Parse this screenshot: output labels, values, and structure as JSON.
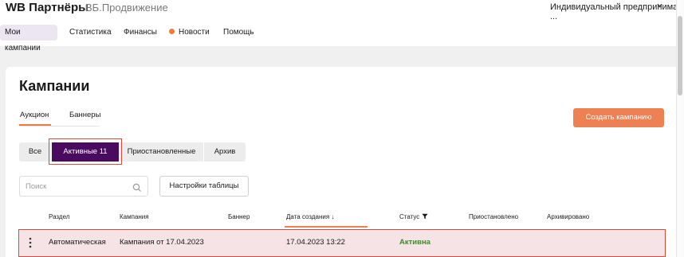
{
  "header": {
    "brand": "WB Партнёры",
    "product": "ВБ.Продвижение",
    "account": "Индивидуальный предпринима ...",
    "account_icon": "chevron-down-icon"
  },
  "nav": {
    "items": [
      {
        "label": "Мои кампании",
        "active": true
      },
      {
        "label": "Статистика"
      },
      {
        "label": "Финансы"
      },
      {
        "label": "Новости",
        "dot_color": "#f07a3e"
      },
      {
        "label": "Помощь"
      }
    ]
  },
  "page": {
    "title": "Кампании",
    "subtabs": [
      {
        "label": "Аукцион",
        "active": true
      },
      {
        "label": "Баннеры"
      }
    ],
    "create_label": "Создать кампанию"
  },
  "filters": {
    "all": "Все",
    "active": "Активные 11",
    "paused": "Приостановленные",
    "archive": "Архив"
  },
  "search": {
    "placeholder": "Поиск",
    "value": ""
  },
  "table_settings_label": "Настройки таблицы",
  "table": {
    "columns": [
      "Раздел",
      "Кампания",
      "Баннер",
      "Дата создания ↓",
      "Статус",
      "Приостановлено",
      "Архивировано"
    ],
    "rows": [
      {
        "section": "Автоматическая",
        "campaign": "Кампания от 17.04.2023",
        "banner": "",
        "created": "17.04.2023 13:22",
        "status": "Активна",
        "paused": "",
        "archived": ""
      }
    ]
  },
  "colors": {
    "accent": "#ee8154",
    "active_filter": "#4a0a5f",
    "status_active": "#3e8a2c",
    "highlight": "#d94a3c"
  }
}
